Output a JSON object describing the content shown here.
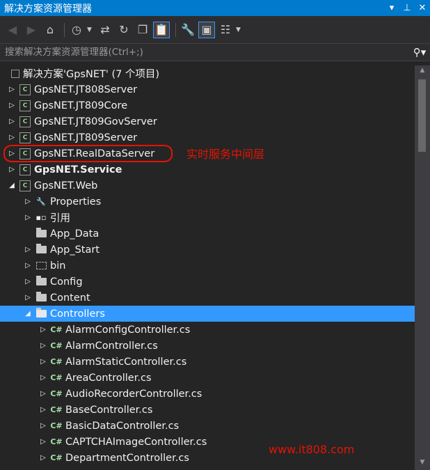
{
  "window": {
    "title": "解决方案资源管理器",
    "buttons": {
      "dropdown": "▾",
      "pin": "⊥",
      "close": "✕"
    }
  },
  "toolbar": {
    "icons": [
      "back-icon",
      "forward-icon",
      "home-icon",
      "history-icon",
      "sync-icon",
      "refresh-icon",
      "collapse-all-icon",
      "show-all-files-icon",
      "properties-icon",
      "preview-icon",
      "class-view-icon"
    ]
  },
  "search": {
    "placeholder": "搜索解决方案资源管理器(Ctrl+;)"
  },
  "tree": {
    "solution": "解决方案'GpsNET' (7 个项目)",
    "projects": [
      {
        "label": "GpsNET.JT808Server"
      },
      {
        "label": "GpsNET.JT809Core"
      },
      {
        "label": "GpsNET.JT809GovServer"
      },
      {
        "label": "GpsNET.JT809Server"
      },
      {
        "label": "GpsNET.RealDataServer"
      },
      {
        "label": "GpsNET.Service"
      },
      {
        "label": "GpsNET.Web"
      }
    ],
    "web_children": [
      {
        "label": "Properties"
      },
      {
        "label": "引用"
      },
      {
        "label": "App_Data"
      },
      {
        "label": "App_Start"
      },
      {
        "label": "bin"
      },
      {
        "label": "Config"
      },
      {
        "label": "Content"
      },
      {
        "label": "Controllers"
      }
    ],
    "controllers": [
      "AlarmConfigController.cs",
      "AlarmController.cs",
      "AlarmStaticController.cs",
      "AreaController.cs",
      "AudioRecorderController.cs",
      "BaseController.cs",
      "BasicDataController.cs",
      "CAPTCHAImageController.cs",
      "DepartmentController.cs"
    ]
  },
  "annotation": "实时服务中间层",
  "watermark": "www.it808.com",
  "colors": {
    "accent": "#007acc",
    "selection": "#3399ff",
    "annotation": "#e51400"
  }
}
